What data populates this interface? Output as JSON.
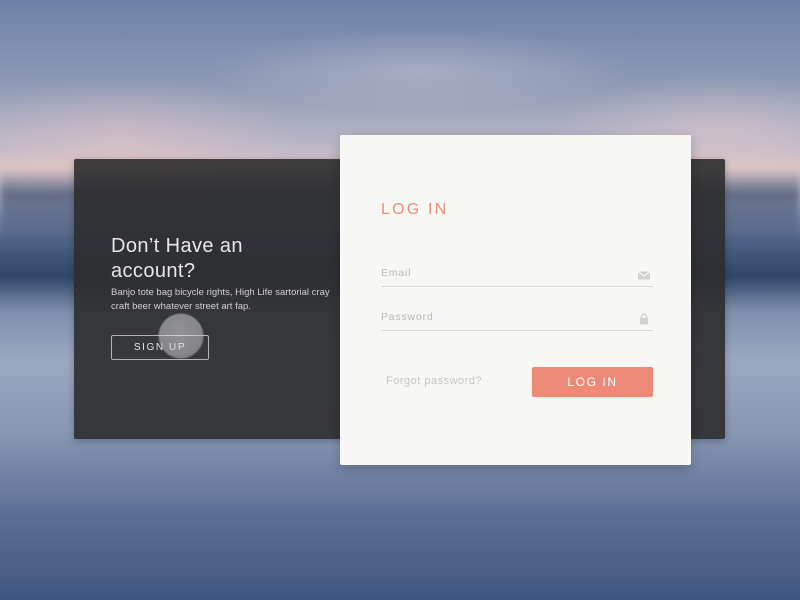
{
  "left_panel": {
    "heading": "Don’t Have an account?",
    "description": "Banjo tote bag bicycle rights, High Life sartorial cray craft beer whatever street art fap.",
    "signup_label": "SIGN UP"
  },
  "login_card": {
    "title": "LOG IN",
    "email_placeholder": "Email",
    "password_placeholder": "Password",
    "forgot_label": "Forgot password?",
    "login_label": "LOG IN"
  },
  "icons": {
    "email": "envelope-icon",
    "password": "lock-icon"
  },
  "colors": {
    "accent": "#ec8a77",
    "title": "#e98c73",
    "dark_panel": "#2c2c2e",
    "card": "#f7f7f6"
  }
}
